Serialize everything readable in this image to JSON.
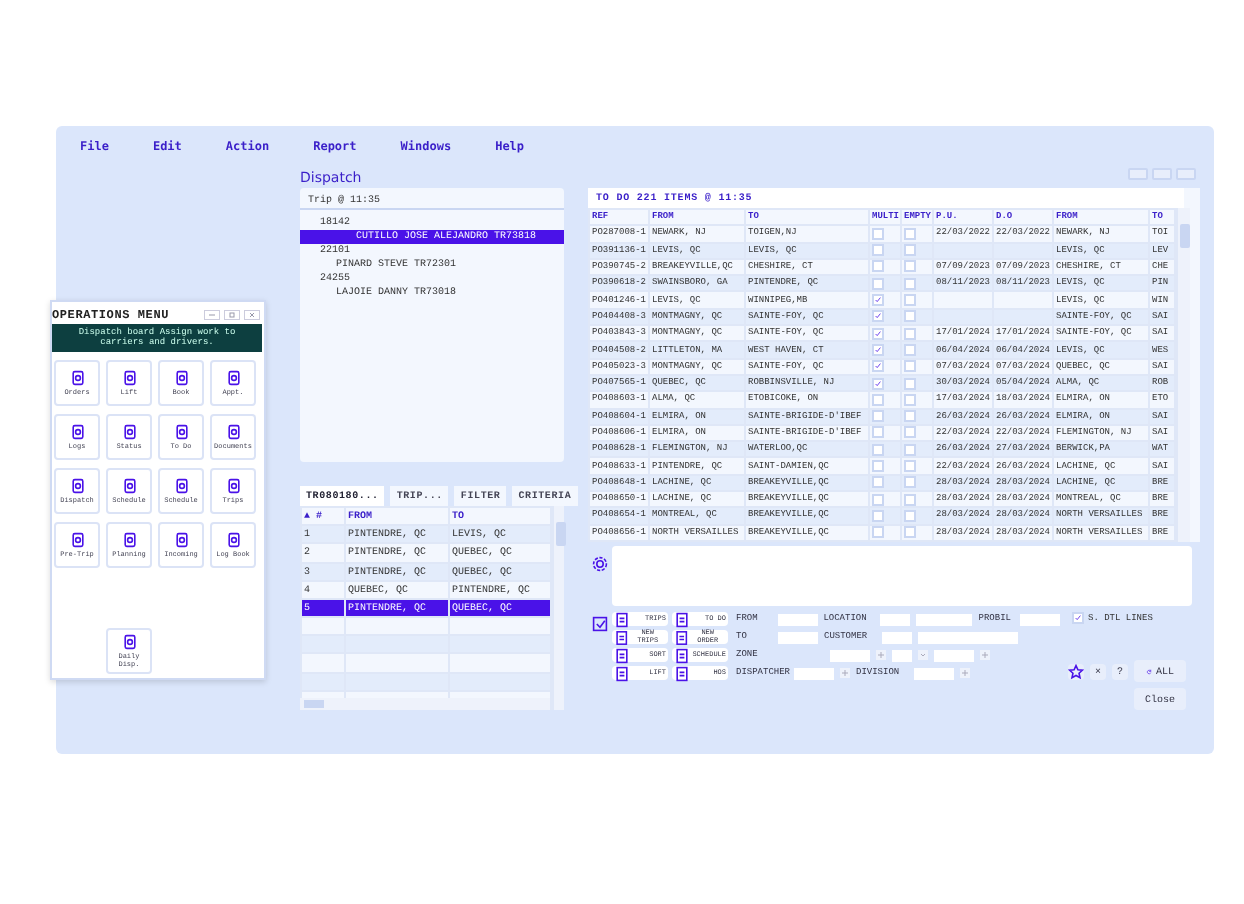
{
  "menu_bar": [
    "File",
    "Edit",
    "Action",
    "Report",
    "Windows",
    "Help"
  ],
  "operations_menu": {
    "title": "OPERATIONS MENU",
    "banner": "Dispatch board Assign work to carriers and drivers.",
    "tiles": [
      "Orders",
      "Lift",
      "Book",
      "Appt.",
      "Logs",
      "Status",
      "To Do",
      "Documents",
      "Dispatch",
      "Schedule",
      "Schedule",
      "Trips",
      "Pre-Trip",
      "Planning",
      "Incoming",
      "Log Book"
    ],
    "extra_tile": "Daily Disp."
  },
  "dispatch": {
    "title": "Dispatch",
    "trip_tree": {
      "header": "Trip @ 11:35",
      "nodes": [
        {
          "label": "18142",
          "children": [
            {
              "label": "CUTILLO JOSE ALEJANDRO TR73818",
              "selected": true
            }
          ]
        },
        {
          "label": "22101",
          "children": [
            {
              "label": "PINARD STEVE TR72301",
              "selected": false
            }
          ]
        },
        {
          "label": "24255",
          "children": [
            {
              "label": "LAJOIE DANNY TR73018",
              "selected": false
            }
          ]
        }
      ]
    },
    "trip_tabs": [
      {
        "label": "TR080180...",
        "selected": true
      },
      {
        "label": "TRIP...",
        "selected": false
      },
      {
        "label": "FILTER",
        "selected": false
      },
      {
        "label": "CRITERIA",
        "selected": false
      }
    ],
    "trip_stops": {
      "columns": [
        "▲ #",
        "FROM",
        "TO"
      ],
      "rows": [
        {
          "cells": [
            "1",
            "PINTENDRE, QC",
            "LEVIS, QC"
          ],
          "selected": false
        },
        {
          "cells": [
            "2",
            "PINTENDRE, QC",
            "QUEBEC, QC"
          ],
          "selected": false
        },
        {
          "cells": [
            "3",
            "PINTENDRE, QC",
            "QUEBEC, QC"
          ],
          "selected": false
        },
        {
          "cells": [
            "4",
            "QUEBEC, QC",
            "PINTENDRE, QC"
          ],
          "selected": false
        },
        {
          "cells": [
            "5",
            "PINTENDRE, QC",
            "QUEBEC, QC"
          ],
          "selected": true
        }
      ]
    },
    "todo": {
      "title": "TO DO 221 ITEMS @ 11:35",
      "columns": [
        "REF",
        "FROM",
        "TO",
        "MULTI",
        "EMPTY",
        "P.U.",
        "D.O",
        "FROM",
        "TO"
      ],
      "rows": [
        {
          "ref": "PO287008-1",
          "from": "NEWARK, NJ",
          "to": "TOIGEN,NJ",
          "multi": false,
          "empty": false,
          "pu": "22/03/2022",
          "do": "22/03/2022",
          "from2": "NEWARK, NJ",
          "to2": "TOI"
        },
        {
          "ref": "PO391136-1",
          "from": "LEVIS, QC",
          "to": "LEVIS, QC",
          "multi": false,
          "empty": false,
          "pu": "",
          "do": "",
          "from2": "LEVIS, QC",
          "to2": "LEV"
        },
        {
          "ref": "PO390745-2",
          "from": "BREAKEYVILLE,QC",
          "to": "CHESHIRE, CT",
          "multi": false,
          "empty": false,
          "pu": "07/09/2023",
          "do": "07/09/2023",
          "from2": "CHESHIRE, CT",
          "to2": "CHE"
        },
        {
          "ref": "PO390618-2",
          "from": "SWAINSBORO, GA",
          "to": "PINTENDRE, QC",
          "multi": false,
          "empty": false,
          "pu": "08/11/2023",
          "do": "08/11/2023",
          "from2": "LEVIS, QC",
          "to2": "PIN"
        },
        {
          "ref": "PO401246-1",
          "from": "LEVIS, QC",
          "to": "WINNIPEG,MB",
          "multi": true,
          "empty": false,
          "pu": "",
          "do": "",
          "from2": "LEVIS, QC",
          "to2": "WIN"
        },
        {
          "ref": "PO404408-3",
          "from": "MONTMAGNY, QC",
          "to": "SAINTE-FOY, QC",
          "multi": true,
          "empty": false,
          "pu": "",
          "do": "",
          "from2": "SAINTE-FOY, QC",
          "to2": "SAI"
        },
        {
          "ref": "PO403843-3",
          "from": "MONTMAGNY, QC",
          "to": "SAINTE-FOY, QC",
          "multi": true,
          "empty": false,
          "pu": "17/01/2024",
          "do": "17/01/2024",
          "from2": "SAINTE-FOY, QC",
          "to2": "SAI"
        },
        {
          "ref": "PO404508-2",
          "from": "LITTLETON, MA",
          "to": "WEST HAVEN, CT",
          "multi": true,
          "empty": false,
          "pu": "06/04/2024",
          "do": "06/04/2024",
          "from2": "LEVIS, QC",
          "to2": "WES"
        },
        {
          "ref": "PO405023-3",
          "from": "MONTMAGNY, QC",
          "to": "SAINTE-FOY, QC",
          "multi": true,
          "empty": false,
          "pu": "07/03/2024",
          "do": "07/03/2024",
          "from2": "QUEBEC, QC",
          "to2": "SAI"
        },
        {
          "ref": "PO407565-1",
          "from": "QUEBEC, QC",
          "to": "ROBBINSVILLE, NJ",
          "multi": true,
          "empty": false,
          "pu": "30/03/2024",
          "do": "05/04/2024",
          "from2": "ALMA, QC",
          "to2": "ROB"
        },
        {
          "ref": "PO408603-1",
          "from": "ALMA, QC",
          "to": "ETOBICOKE, ON",
          "multi": false,
          "empty": false,
          "pu": "17/03/2024",
          "do": "18/03/2024",
          "from2": "ELMIRA, ON",
          "to2": "ETO"
        },
        {
          "ref": "PO408604-1",
          "from": "ELMIRA, ON",
          "to": "SAINTE-BRIGIDE-D'IBEF",
          "multi": false,
          "empty": false,
          "pu": "26/03/2024",
          "do": "26/03/2024",
          "from2": "ELMIRA, ON",
          "to2": "SAI"
        },
        {
          "ref": "PO408606-1",
          "from": "ELMIRA, ON",
          "to": "SAINTE-BRIGIDE-D'IBEF",
          "multi": false,
          "empty": false,
          "pu": "22/03/2024",
          "do": "22/03/2024",
          "from2": "FLEMINGTON, NJ",
          "to2": "SAI"
        },
        {
          "ref": "PO408628-1",
          "from": "FLEMINGTON, NJ",
          "to": "WATERLOO,QC",
          "multi": false,
          "empty": false,
          "pu": "26/03/2024",
          "do": "27/03/2024",
          "from2": "BERWICK,PA",
          "to2": "WAT"
        },
        {
          "ref": "PO408633-1",
          "from": "PINTENDRE, QC",
          "to": "SAINT-DAMIEN,QC",
          "multi": false,
          "empty": false,
          "pu": "22/03/2024",
          "do": "26/03/2024",
          "from2": "LACHINE, QC",
          "to2": "SAI"
        },
        {
          "ref": "PO408648-1",
          "from": "LACHINE, QC",
          "to": "BREAKEYVILLE,QC",
          "multi": false,
          "empty": false,
          "pu": "28/03/2024",
          "do": "28/03/2024",
          "from2": "LACHINE, QC",
          "to2": "BRE"
        },
        {
          "ref": "PO408650-1",
          "from": "LACHINE, QC",
          "to": "BREAKEYVILLE,QC",
          "multi": false,
          "empty": false,
          "pu": "28/03/2024",
          "do": "28/03/2024",
          "from2": "MONTREAL, QC",
          "to2": "BRE"
        },
        {
          "ref": "PO408654-1",
          "from": "MONTREAL, QC",
          "to": "BREAKEYVILLE,QC",
          "multi": false,
          "empty": false,
          "pu": "28/03/2024",
          "do": "28/03/2024",
          "from2": "NORTH VERSAILLES",
          "to2": "BRE"
        },
        {
          "ref": "PO408656-1",
          "from": "NORTH VERSAILLES",
          "to": "BREAKEYVILLE,QC",
          "multi": false,
          "empty": false,
          "pu": "28/03/2024",
          "do": "28/03/2024",
          "from2": "NORTH VERSAILLES",
          "to2": "BRE"
        }
      ]
    },
    "actions": [
      "TRIPS",
      "TO DO",
      "NEW TRIPS",
      "NEW ORDER",
      "SORT",
      "SCHEDULE",
      "LIFT",
      "HOS"
    ],
    "filters": {
      "from": "FROM",
      "location": "LOCATION",
      "probil": "PROBIL",
      "to": "TO",
      "customer": "CUSTOMER",
      "zone": "ZONE",
      "dispatcher": "DISPATCHER",
      "division": "DIVISION"
    },
    "detail_lines": {
      "label": "S. DTL LINES",
      "checked": true
    },
    "small_buttons": [
      "×",
      "?"
    ],
    "all_button": "ALL",
    "close_button": "Close"
  }
}
